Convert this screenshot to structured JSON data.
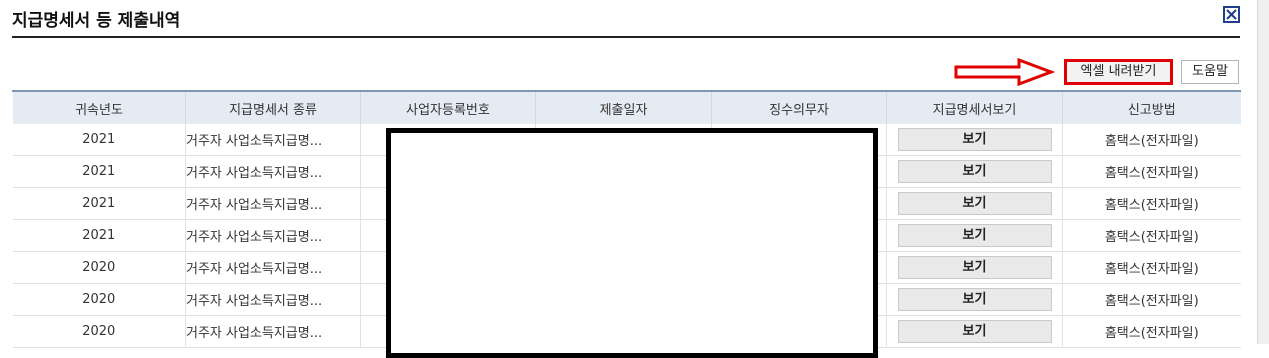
{
  "page": {
    "title": "지급명세서 등 제출내역"
  },
  "toolbar": {
    "excel_label": "엑셀 내려받기",
    "help_label": "도움말"
  },
  "table": {
    "headers": [
      "귀속년도",
      "지급명세서 종류",
      "사업자등록번호",
      "제출일자",
      "징수의무자",
      "지급명세서보기",
      "신고방법"
    ],
    "rows": [
      {
        "year": "2021",
        "type": "거주자 사업소득지급명...",
        "view": "보기",
        "method": "홈택스(전자파일)"
      },
      {
        "year": "2021",
        "type": "거주자 사업소득지급명...",
        "view": "보기",
        "method": "홈택스(전자파일)"
      },
      {
        "year": "2021",
        "type": "거주자 사업소득지급명...",
        "view": "보기",
        "method": "홈택스(전자파일)"
      },
      {
        "year": "2021",
        "type": "거주자 사업소득지급명...",
        "view": "보기",
        "method": "홈택스(전자파일)"
      },
      {
        "year": "2020",
        "type": "거주자 사업소득지급명...",
        "view": "보기",
        "method": "홈택스(전자파일)"
      },
      {
        "year": "2020",
        "type": "거주자 사업소득지급명...",
        "view": "보기",
        "method": "홈택스(전자파일)"
      },
      {
        "year": "2020",
        "type": "거주자 사업소득지급명...",
        "view": "보기",
        "method": "홈택스(전자파일)"
      }
    ]
  },
  "icons": {
    "close": "close-icon",
    "annotation": "arrow-right-icon"
  },
  "colors": {
    "header_bg": "#e5ebf3",
    "highlight": "#e00000",
    "close_icon": "#1f3f8a"
  }
}
